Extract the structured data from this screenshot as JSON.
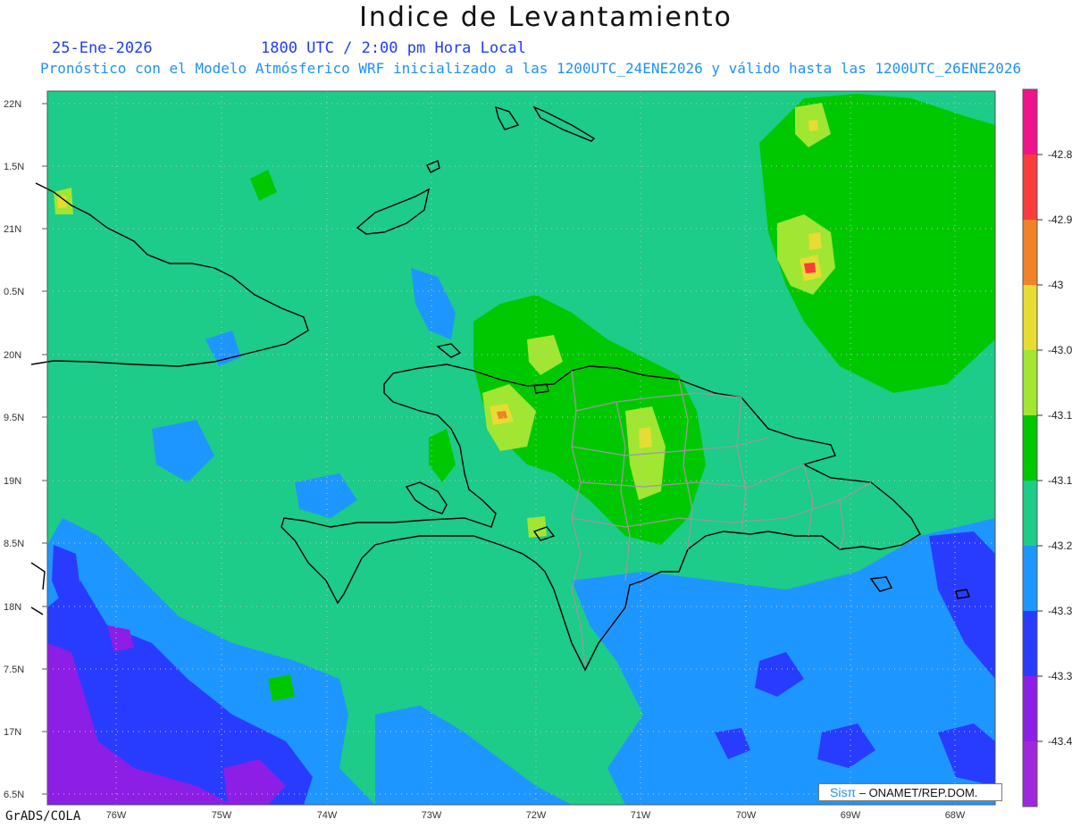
{
  "header": {
    "title": "Indice de Levantamiento",
    "date": "25-Ene-2026",
    "time": "1800 UTC / 2:00 pm Hora Local",
    "description": "Pronóstico con el Modelo Atmósferico WRF inicializado a las 1200UTC_24ENE2026 y válido hasta las  1200UTC_26ENE2026"
  },
  "map": {
    "lat_labels": [
      "22N",
      "1.5N",
      "21N",
      "0.5N",
      "20N",
      "9.5N",
      "19N",
      "8.5N",
      "18N",
      "7.5N",
      "17N",
      "6.5N"
    ],
    "lon_labels": [
      "76W",
      "75W",
      "74W",
      "73W",
      "72W",
      "71W",
      "70W",
      "69W",
      "68W"
    ],
    "region": "Hispaniola / Cuba / Bahamas",
    "background_color": "#1ccc88"
  },
  "colorbar": {
    "labels": [
      "-42.8",
      "-42.9",
      "-43",
      "-43.0",
      "-43.1",
      "-43.1",
      "-43.2",
      "-43.3",
      "-43.3",
      "-43.4"
    ],
    "colors": [
      "#f0148c",
      "#fa3c3c",
      "#f08228",
      "#e6dc32",
      "#a0e632",
      "#00c800",
      "#1ccc88",
      "#1e96ff",
      "#283cff",
      "#8c1ee6",
      "#a028dc"
    ]
  },
  "footer": {
    "software": "GrADS/COLA",
    "brand": "Sisπ",
    "org": " – ONAMET/REP.DOM."
  }
}
